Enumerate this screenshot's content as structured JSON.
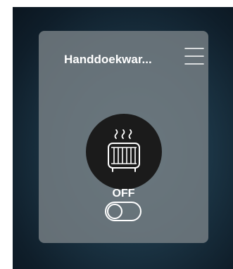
{
  "device_card": {
    "title": "Handdoekwar...",
    "state_label": "OFF",
    "toggle_on": false
  },
  "icons": {
    "menu": "hamburger-menu-icon",
    "device": "towel-radiator-heat-icon"
  },
  "colors": {
    "card_bg": "#7a8287",
    "device_circle": "#1b1b1b",
    "foreground": "#ffffff"
  }
}
